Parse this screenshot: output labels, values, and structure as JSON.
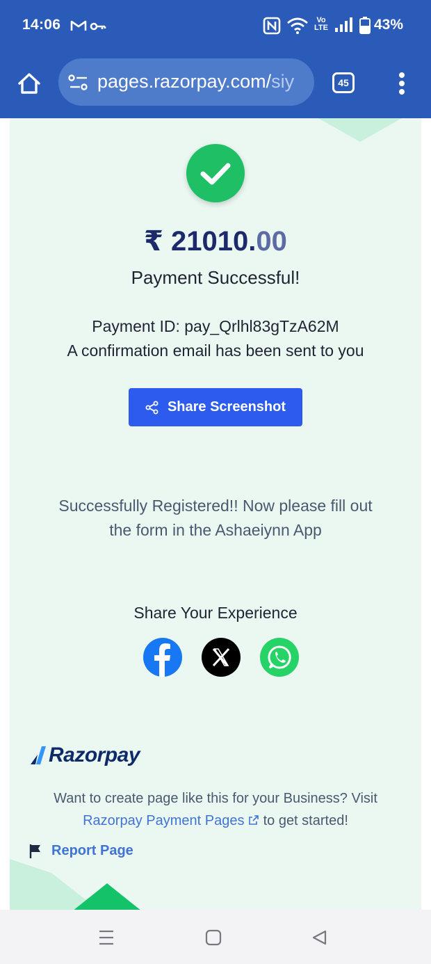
{
  "status_bar": {
    "time": "14:06",
    "battery_percent": "43%",
    "volte": "Vo LTE"
  },
  "browser": {
    "url_main": "pages.razorpay.com/",
    "url_faded": "siy",
    "tab_count": "45"
  },
  "payment": {
    "amount_whole": "₹ 21010.",
    "amount_decimal": "00",
    "status_message": "Payment Successful!",
    "payment_id_line": "Payment ID: pay_Qrlhl83gTzA62M",
    "email_line": "A confirmation email has been sent to you",
    "share_button_label": "Share Screenshot"
  },
  "message": {
    "line1": "Successfully Registered!! Now please fill out",
    "line2": "the form in the Ashaeiynn App"
  },
  "share": {
    "heading": "Share Your Experience",
    "icons": [
      "facebook-icon",
      "x-twitter-icon",
      "whatsapp-icon"
    ]
  },
  "footer": {
    "brand": "Razorpay",
    "promo_line1": "Want to create page like this for your Business? Visit",
    "promo_link": "Razorpay Payment Pages",
    "promo_tail": "to get started!",
    "report_label": "Report Page"
  },
  "colors": {
    "header_blue": "#2b5bb8",
    "card_bg": "#ebf8f1",
    "success_green": "#1fbf66",
    "button_blue": "#2d5bee",
    "amount_navy": "#1c2a6b",
    "link_blue": "#3f73d4"
  }
}
